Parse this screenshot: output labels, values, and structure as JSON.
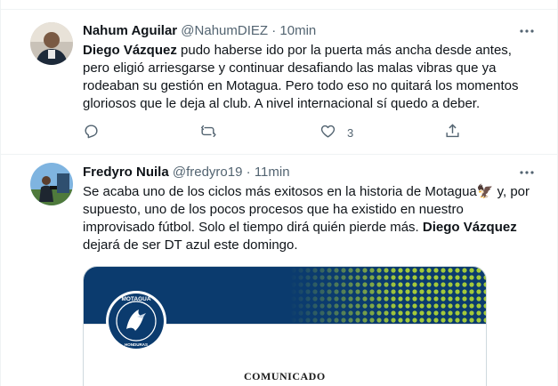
{
  "tweets": [
    {
      "display_name": "Nahum Aguilar",
      "handle": "@NahumDIEZ",
      "separator": "·",
      "time": "10min",
      "text_lines": [
        [
          {
            "t": "Diego Vázquez",
            "b": true
          },
          {
            "t": " pudo haberse ido por la puerta más ancha desde antes,",
            "b": false
          }
        ],
        [
          {
            "t": "pero eligió arriesgarse y continuar desafiando las malas vibras que ya",
            "b": false
          }
        ],
        [
          {
            "t": "rodeaban su gestión en Motagua. Pero todo eso no quitará los momentos",
            "b": false
          }
        ],
        [
          {
            "t": "gloriosos que le deja al club. A nivel internacional sí quedo a deber.",
            "b": false
          }
        ]
      ],
      "actions": {
        "reply_count": "",
        "retweet_count": "",
        "like_count": "3",
        "share_count": ""
      }
    },
    {
      "display_name": "Fredyro Nuila",
      "handle": "@fredyro19",
      "separator": "·",
      "time": "11min",
      "text_lines": [
        [
          {
            "t": "Se acaba uno de los ciclos más exitosos en la historia de Motagua",
            "b": false
          },
          {
            "t": "🦅",
            "b": false
          },
          {
            "t": "  y, por",
            "b": false
          }
        ],
        [
          {
            "t": "supuesto, uno de los pocos procesos que ha existido en nuestro",
            "b": false
          }
        ],
        [
          {
            "t": "improvisado fútbol. Solo el tiempo dirá quién pierde más. ",
            "b": false
          },
          {
            "t": "Diego Vázquez",
            "b": true
          }
        ],
        [
          {
            "t": "dejará de ser DT azul este domingo.",
            "b": false
          }
        ]
      ],
      "media": {
        "club_name": "MOTAGUA",
        "club_country": "HONDURAS",
        "heading": "COMUNICADO"
      }
    }
  ],
  "colors": {
    "text_primary": "#0f1419",
    "text_secondary": "#536471",
    "divider": "#eff3f4",
    "club_blue": "#0b3b6e",
    "club_green": "#a3c93a"
  },
  "icons": [
    "more-icon",
    "reply-icon",
    "retweet-icon",
    "like-icon",
    "share-icon"
  ]
}
